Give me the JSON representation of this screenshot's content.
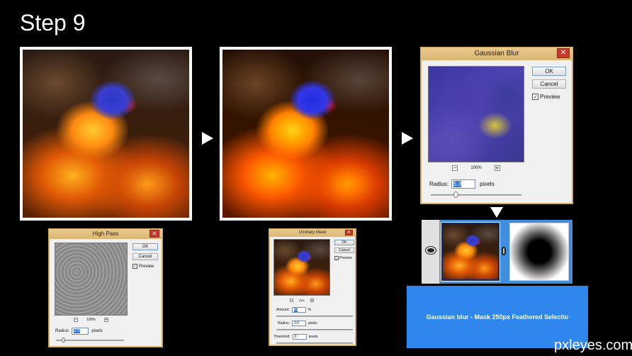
{
  "title": "Step 9",
  "high_pass": {
    "title": "High Pass",
    "ok": "OK",
    "cancel": "Cancel",
    "preview": "Preview",
    "zoom": "100%",
    "radius_label": "Radius:",
    "radius_value": "2.0",
    "unit": "pixels"
  },
  "unsharp_mask": {
    "title": "Unsharp Mask",
    "ok": "OK",
    "cancel": "Cancel",
    "preview": "Preview",
    "zoom": "25%",
    "amount_label": "Amount:",
    "amount_value": "50",
    "amount_unit": "%",
    "radius_label": "Radius:",
    "radius_value": "2.0",
    "radius_unit": "pixels",
    "threshold_label": "Threshold:",
    "threshold_value": "0",
    "threshold_unit": "levels"
  },
  "gaussian_blur": {
    "title": "Gaussian Blur",
    "ok": "OK",
    "cancel": "Cancel",
    "preview": "Preview",
    "zoom": "100%",
    "radius_label": "Radius:",
    "radius_value": "5.3",
    "unit": "pixels"
  },
  "caption": "Gaussian blur - Mask 250px Feathered Selectio",
  "watermark": "pxleyes.com",
  "icons": {
    "arrow1": "arrow-right-icon",
    "arrow2": "arrow-right-icon",
    "arrow3": "arrow-down-icon",
    "eye": "eye-icon",
    "chain": "chain-link-icon",
    "close": "close-icon",
    "check": "checkmark-icon"
  }
}
